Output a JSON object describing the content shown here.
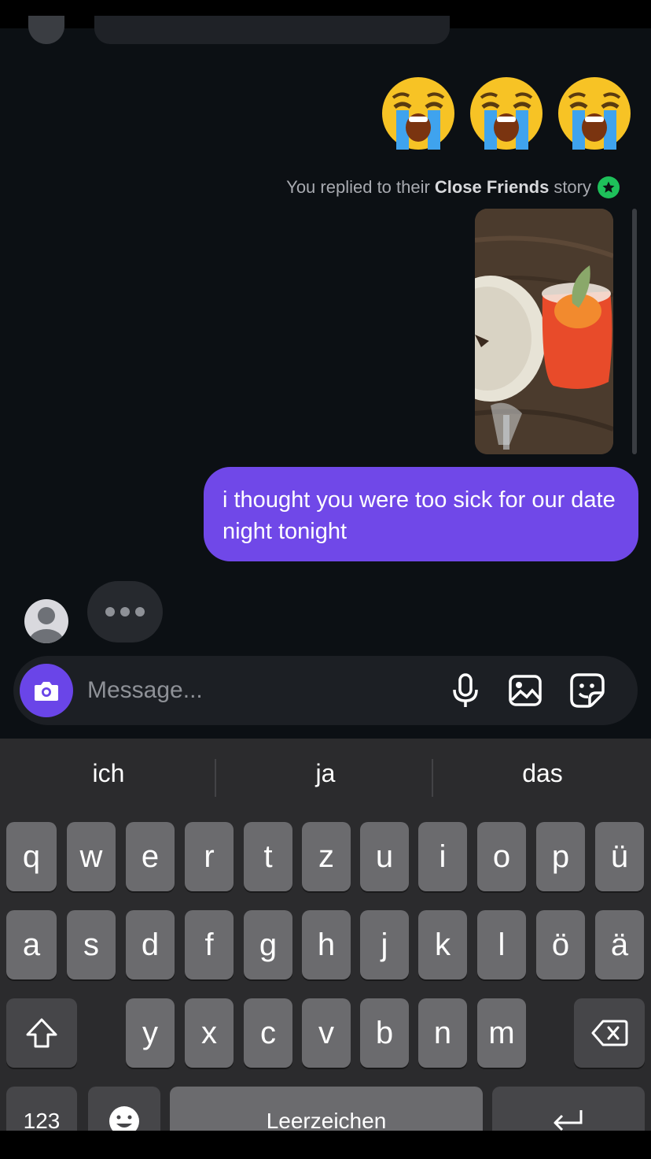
{
  "conversation": {
    "emojis": [
      "loudly-crying-face",
      "loudly-crying-face",
      "loudly-crying-face"
    ],
    "reply_note": {
      "prefix": "You replied to their",
      "highlight": "Close Friends",
      "suffix": "story"
    },
    "outgoing_message": "i thought you were too sick for our date night tonight",
    "typing_indicator": "..."
  },
  "composer": {
    "placeholder": "Message...",
    "icons": [
      "camera-icon",
      "microphone-icon",
      "gallery-icon",
      "sticker-icon"
    ]
  },
  "keyboard": {
    "suggestions": [
      "ich",
      "ja",
      "das"
    ],
    "row1": [
      "q",
      "w",
      "e",
      "r",
      "t",
      "z",
      "u",
      "i",
      "o",
      "p",
      "ü"
    ],
    "row2": [
      "a",
      "s",
      "d",
      "f",
      "g",
      "h",
      "j",
      "k",
      "l",
      "ö",
      "ä"
    ],
    "row3": [
      "y",
      "x",
      "c",
      "v",
      "b",
      "n",
      "m"
    ],
    "numbers_label": "123",
    "space_label": "Leerzeichen"
  },
  "colors": {
    "background": "#0c1014",
    "outgoing_bubble": "#7048e8",
    "close_friends_badge": "#1ec05a",
    "keyboard_bg": "#2b2b2d"
  }
}
